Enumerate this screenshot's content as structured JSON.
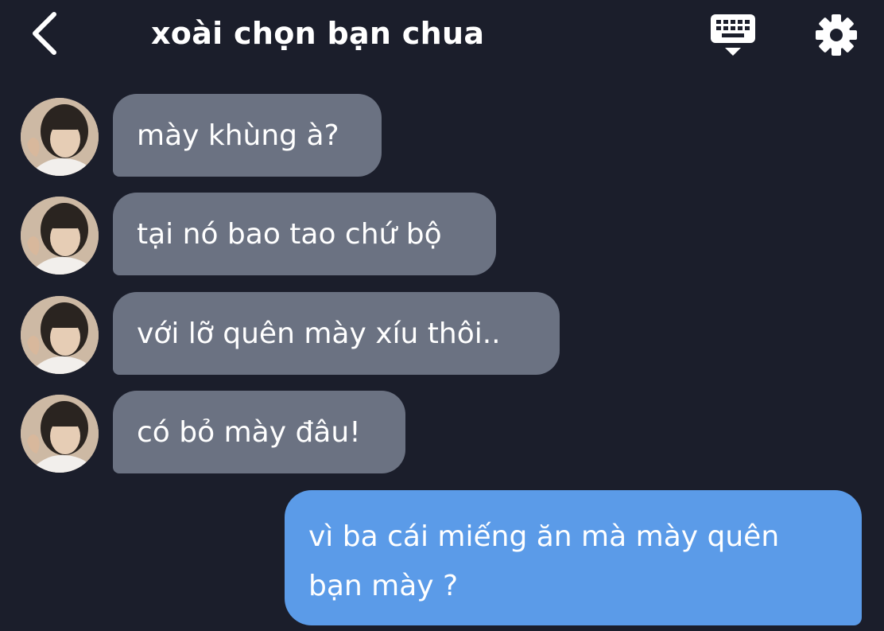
{
  "header": {
    "title": "xoài chọn bạn chua",
    "back_icon": "chevron-left-icon",
    "keyboard_icon": "keyboard-icon",
    "settings_icon": "gear-icon"
  },
  "messages": [
    {
      "side": "incoming",
      "text": "mày khùng à?"
    },
    {
      "side": "incoming",
      "text": "tại nó bao tao chứ bộ"
    },
    {
      "side": "incoming",
      "text": "với lỡ quên mày xíu thôi.."
    },
    {
      "side": "incoming",
      "text": "có bỏ mày đâu!"
    },
    {
      "side": "outgoing",
      "lines": [
        "vì ba cái miếng ăn mà mày quên",
        "bạn mày ?"
      ]
    }
  ],
  "colors": {
    "background": "#1b1e2b",
    "incoming_bubble": "#6b7282",
    "outgoing_bubble": "#5b9be8",
    "text": "#ffffff"
  }
}
